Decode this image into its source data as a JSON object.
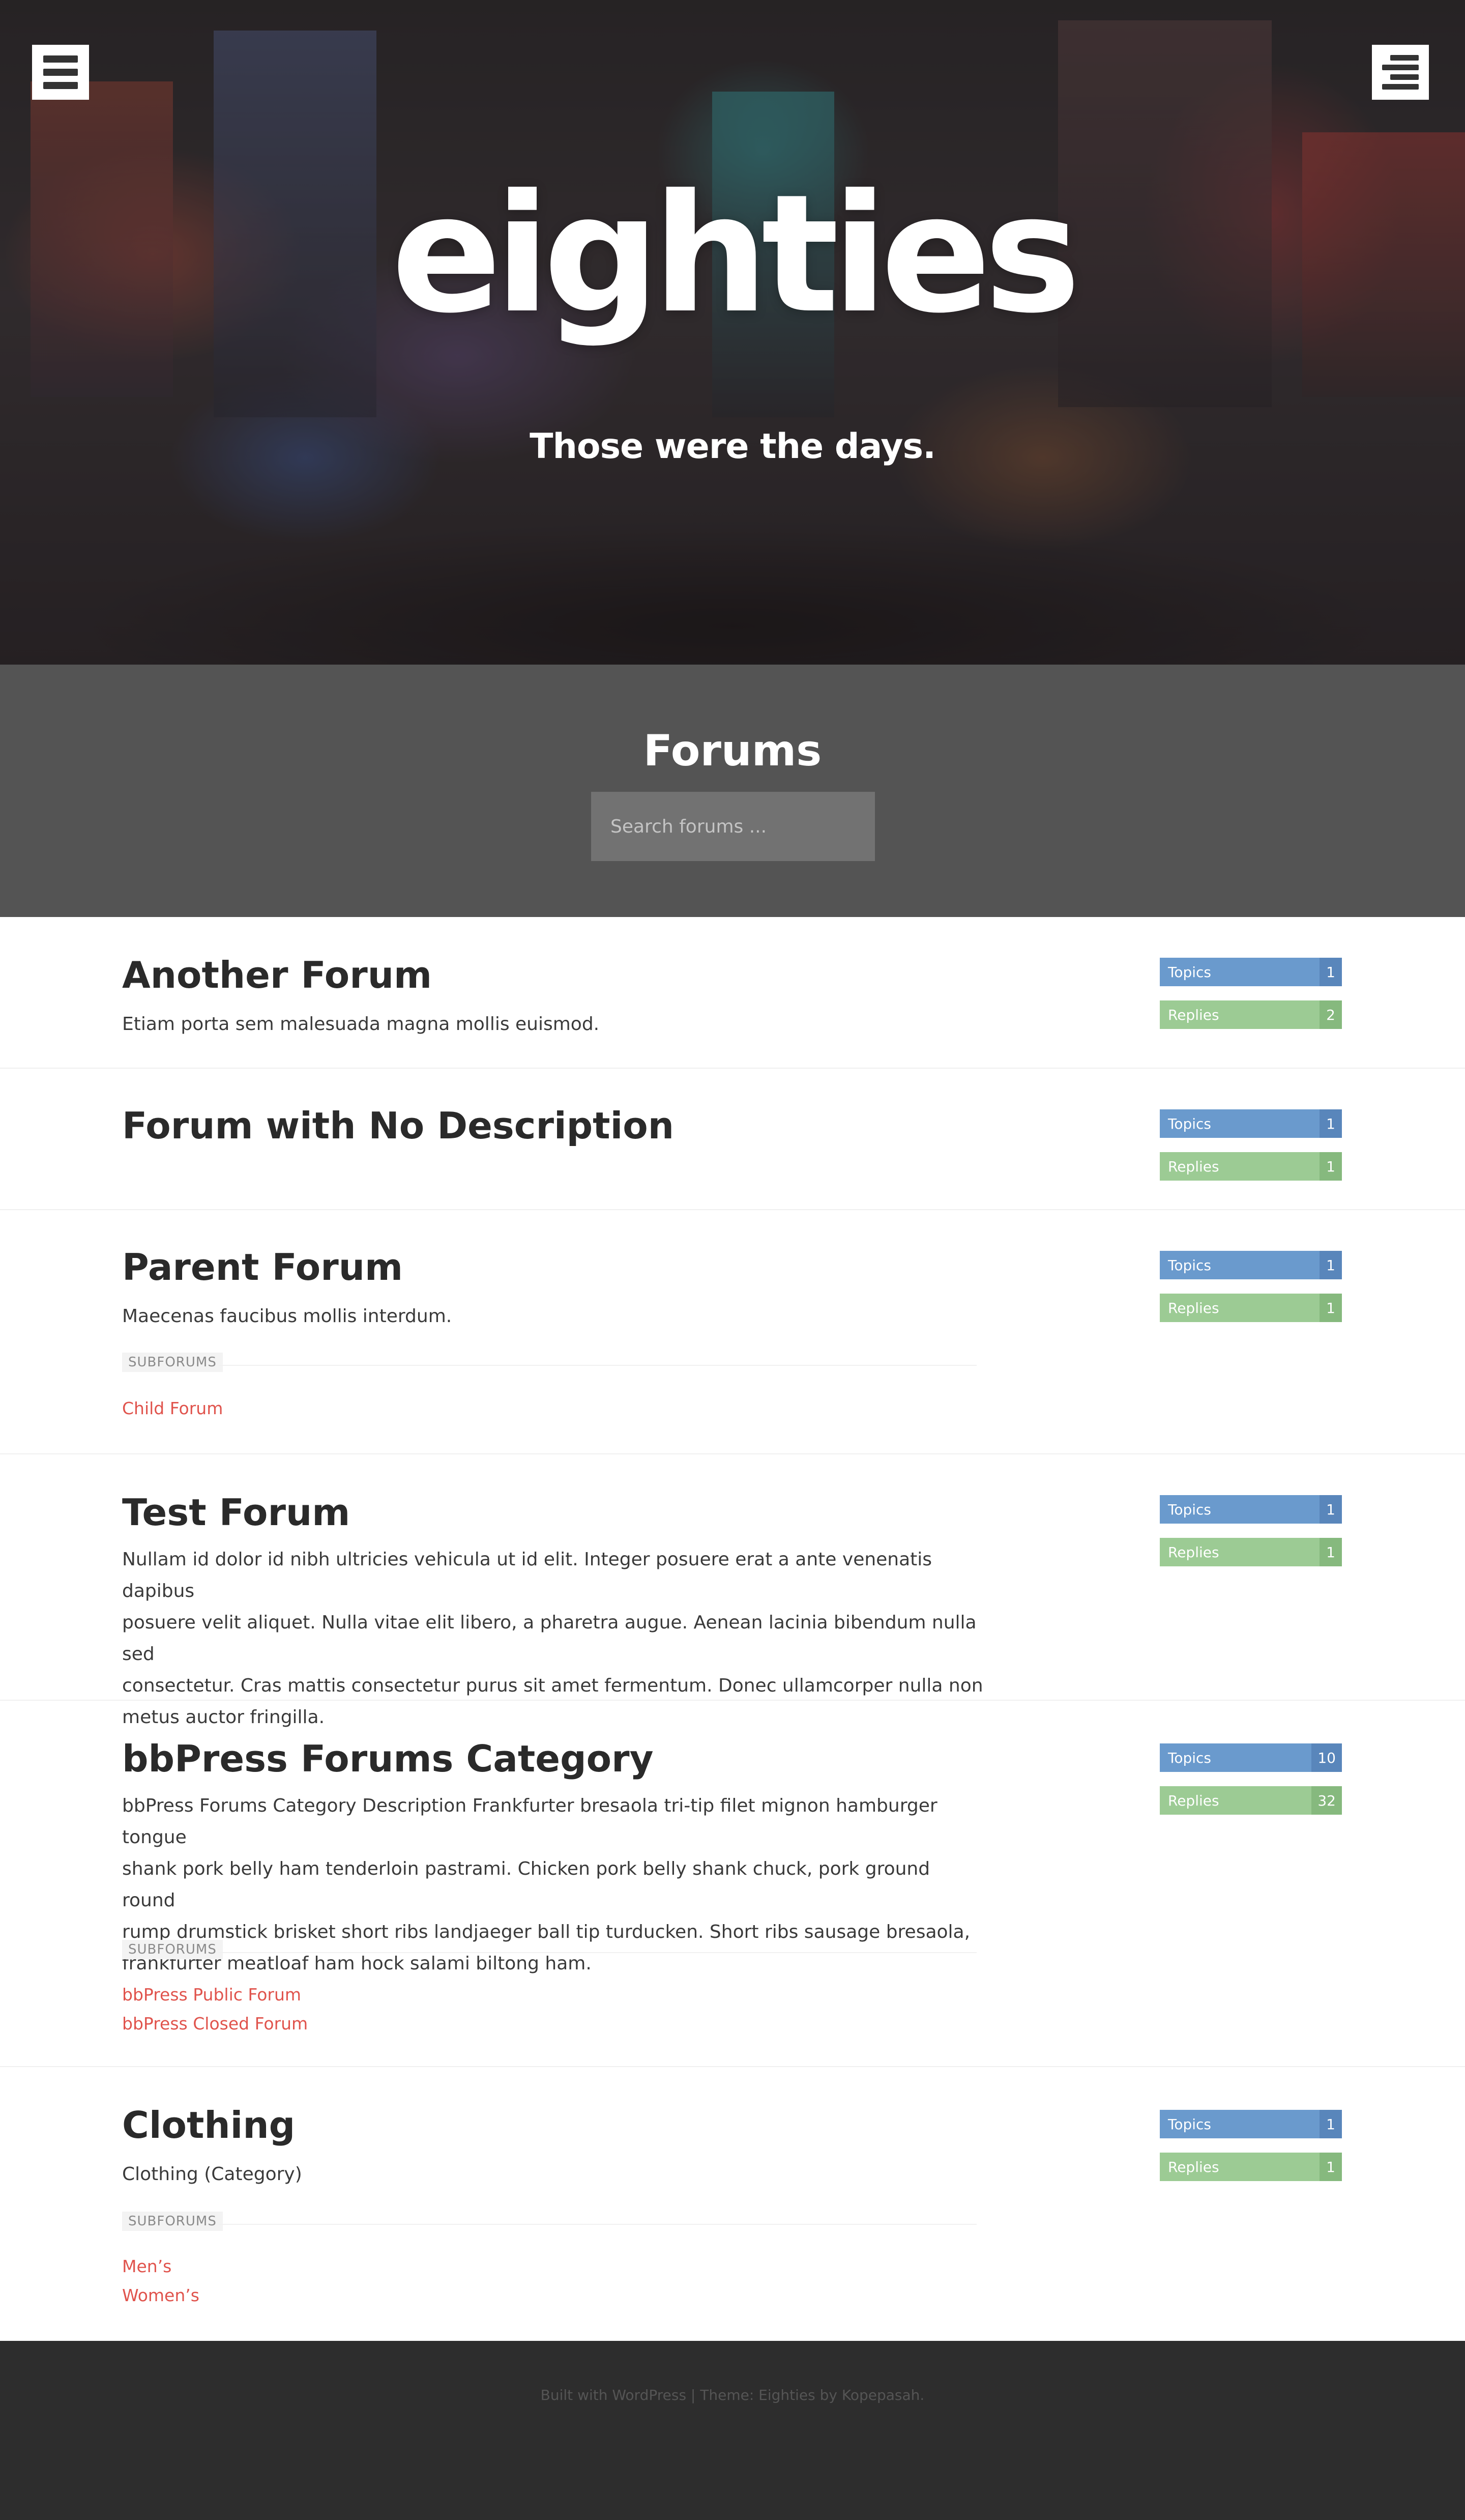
{
  "site": {
    "title": "eighties",
    "tagline": "Those were the days."
  },
  "header": {
    "left_menu_icon": "hamburger-menu-icon",
    "right_menu_icon": "sidebar-menu-icon"
  },
  "forums_section": {
    "title": "Forums",
    "search_placeholder": "Search forums ..."
  },
  "forums": [
    {
      "title": "Another Forum",
      "description": "Etiam porta sem malesuada magna mollis euismod.",
      "topics_label": "Topics",
      "topics": "1",
      "replies_label": "Replies",
      "replies": "2"
    },
    {
      "title": "Forum with No Description",
      "description": "",
      "topics_label": "Topics",
      "topics": "1",
      "replies_label": "Replies",
      "replies": "1"
    },
    {
      "title": "Parent Forum",
      "description": "Maecenas faucibus mollis interdum.",
      "subforums_label": "SUBFORUMS",
      "subforums": [
        "Child Forum"
      ],
      "topics_label": "Topics",
      "topics": "1",
      "replies_label": "Replies",
      "replies": "1"
    },
    {
      "title": "Test Forum",
      "description_lines": [
        "Nullam id dolor id nibh ultricies vehicula ut id elit. Integer posuere erat a ante venenatis dapibus",
        "posuere velit aliquet. Nulla vitae elit libero, a pharetra augue. Aenean lacinia bibendum nulla sed",
        "consectetur. Cras mattis consectetur purus sit amet fermentum. Donec ullamcorper nulla non",
        "metus auctor fringilla."
      ],
      "topics_label": "Topics",
      "topics": "1",
      "replies_label": "Replies",
      "replies": "1"
    },
    {
      "title": "bbPress Forums Category",
      "description_lines": [
        "bbPress Forums Category Description Frankfurter bresaola tri-tip filet mignon hamburger tongue",
        "shank pork belly ham tenderloin pastrami. Chicken pork belly shank chuck, pork ground round",
        "rump drumstick brisket short ribs landjaeger ball tip turducken. Short ribs sausage bresaola,",
        "frankfurter meatloaf ham hock salami biltong ham."
      ],
      "subforums_label": "SUBFORUMS",
      "subforums": [
        "bbPress Public Forum",
        "bbPress Closed Forum"
      ],
      "topics_label": "Topics",
      "topics": "10",
      "replies_label": "Replies",
      "replies": "32"
    },
    {
      "title": "Clothing",
      "description": "Clothing (Category)",
      "subforums_label": "SUBFORUMS",
      "subforums": [
        "Men’s",
        "Women’s"
      ],
      "topics_label": "Topics",
      "topics": "1",
      "replies_label": "Replies",
      "replies": "1"
    }
  ],
  "footer": {
    "text": "Built with WordPress | Theme: Eighties by Kopepasah."
  },
  "colors": {
    "topics_bar": "#6a9acd",
    "replies_bar": "#9ccb94",
    "link": "#e0534c",
    "header_band": "#545454",
    "footer_bg": "#2d2d2d"
  }
}
